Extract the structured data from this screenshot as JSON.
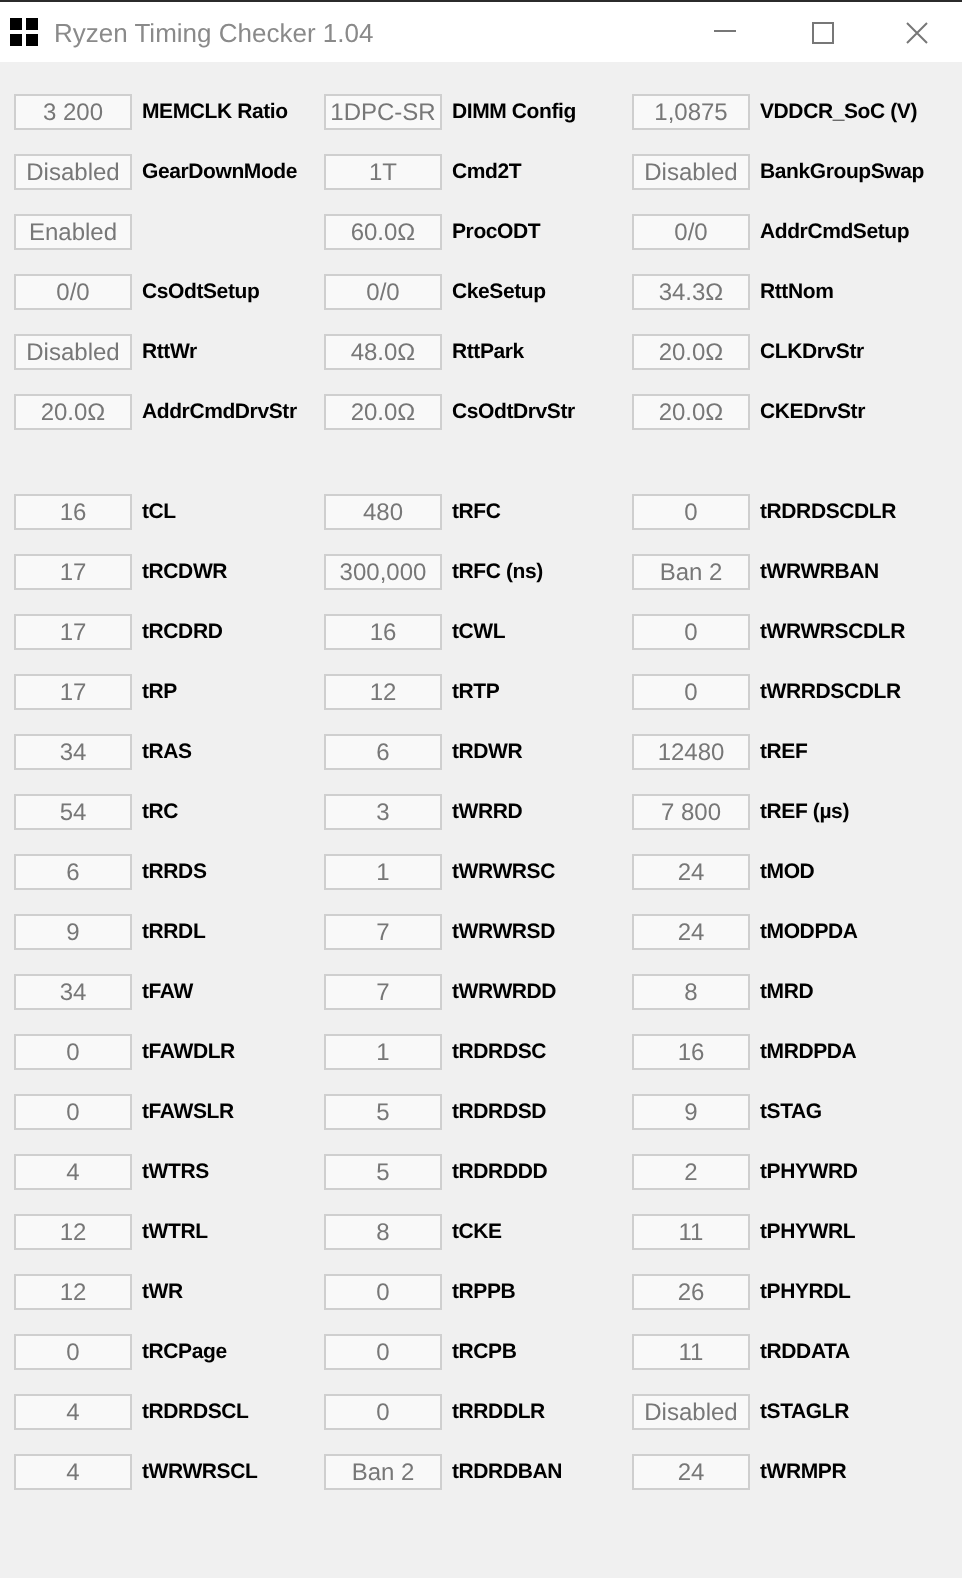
{
  "window": {
    "title": "Ryzen Timing Checker 1.04"
  },
  "general": [
    {
      "value": "3 200",
      "label": "MEMCLK Ratio"
    },
    {
      "value": "1DPC-SR",
      "label": "DIMM Config"
    },
    {
      "value": "1,0875",
      "label": "VDDCR_SoC (V)"
    },
    {
      "value": "Disabled",
      "label": "GearDownMode"
    },
    {
      "value": "1T",
      "label": "Cmd2T"
    },
    {
      "value": "Disabled",
      "label": "BankGroupSwap"
    },
    {
      "value": "Enabled"
    },
    {
      "value": "60.0Ω",
      "label": "ProcODT"
    },
    {
      "value": "0/0",
      "label": "AddrCmdSetup"
    },
    {
      "value": "0/0",
      "label": "CsOdtSetup"
    },
    {
      "value": "0/0",
      "label": "CkeSetup"
    },
    {
      "value": "34.3Ω",
      "label": "RttNom"
    },
    {
      "value": "Disabled",
      "label": "RttWr"
    },
    {
      "value": "48.0Ω",
      "label": "RttPark"
    },
    {
      "value": "20.0Ω",
      "label": "CLKDrvStr"
    },
    {
      "value": "20.0Ω",
      "label": "AddrCmdDrvStr"
    },
    {
      "value": "20.0Ω",
      "label": "CsOdtDrvStr"
    },
    {
      "value": "20.0Ω",
      "label": "CKEDrvStr"
    }
  ],
  "timings": [
    {
      "value": "16",
      "label": "tCL"
    },
    {
      "value": "480",
      "label": "tRFC"
    },
    {
      "value": "0",
      "label": "tRDRDSCDLR"
    },
    {
      "value": "17",
      "label": "tRCDWR"
    },
    {
      "value": "300,000",
      "label": "tRFC (ns)"
    },
    {
      "value": "Ban 2",
      "label": "tWRWRBAN"
    },
    {
      "value": "17",
      "label": "tRCDRD"
    },
    {
      "value": "16",
      "label": "tCWL"
    },
    {
      "value": "0",
      "label": "tWRWRSCDLR"
    },
    {
      "value": "17",
      "label": "tRP"
    },
    {
      "value": "12",
      "label": "tRTP"
    },
    {
      "value": "0",
      "label": "tWRRDSCDLR"
    },
    {
      "value": "34",
      "label": "tRAS"
    },
    {
      "value": "6",
      "label": "tRDWR"
    },
    {
      "value": "12480",
      "label": "tREF"
    },
    {
      "value": "54",
      "label": "tRC"
    },
    {
      "value": "3",
      "label": "tWRRD"
    },
    {
      "value": "7 800",
      "label": "tREF (µs)"
    },
    {
      "value": "6",
      "label": "tRRDS"
    },
    {
      "value": "1",
      "label": "tWRWRSC"
    },
    {
      "value": "24",
      "label": "tMOD"
    },
    {
      "value": "9",
      "label": "tRRDL"
    },
    {
      "value": "7",
      "label": "tWRWRSD"
    },
    {
      "value": "24",
      "label": "tMODPDA"
    },
    {
      "value": "34",
      "label": "tFAW"
    },
    {
      "value": "7",
      "label": "tWRWRDD"
    },
    {
      "value": "8",
      "label": "tMRD"
    },
    {
      "value": "0",
      "label": "tFAWDLR"
    },
    {
      "value": "1",
      "label": "tRDRDSC"
    },
    {
      "value": "16",
      "label": "tMRDPDA"
    },
    {
      "value": "0",
      "label": "tFAWSLR"
    },
    {
      "value": "5",
      "label": "tRDRDSD"
    },
    {
      "value": "9",
      "label": "tSTAG"
    },
    {
      "value": "4",
      "label": "tWTRS"
    },
    {
      "value": "5",
      "label": "tRDRDDD"
    },
    {
      "value": "2",
      "label": "tPHYWRD"
    },
    {
      "value": "12",
      "label": "tWTRL"
    },
    {
      "value": "8",
      "label": "tCKE"
    },
    {
      "value": "11",
      "label": "tPHYWRL"
    },
    {
      "value": "12",
      "label": "tWR"
    },
    {
      "value": "0",
      "label": "tRPPB"
    },
    {
      "value": "26",
      "label": "tPHYRDL"
    },
    {
      "value": "0",
      "label": "tRCPage"
    },
    {
      "value": "0",
      "label": "tRCPB"
    },
    {
      "value": "11",
      "label": "tRDDATA"
    },
    {
      "value": "4",
      "label": "tRDRDSCL"
    },
    {
      "value": "0",
      "label": "tRRDDLR"
    },
    {
      "value": "Disabled",
      "label": "tSTAGLR"
    },
    {
      "value": "4",
      "label": "tWRWRSCL"
    },
    {
      "value": "Ban 2",
      "label": "tRDRDBAN"
    },
    {
      "value": "24",
      "label": "tWRMPR"
    }
  ]
}
